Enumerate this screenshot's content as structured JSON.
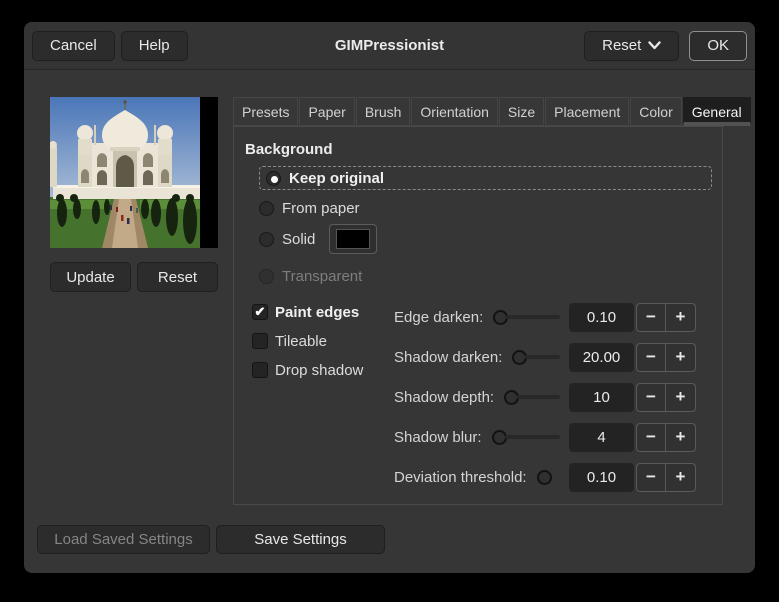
{
  "window": {
    "title": "GIMPressionist"
  },
  "header": {
    "cancel_label": "Cancel",
    "help_label": "Help",
    "reset_label": "Reset",
    "ok_label": "OK"
  },
  "preview": {
    "update_label": "Update",
    "reset_label": "Reset"
  },
  "tabs": [
    {
      "label": "Presets"
    },
    {
      "label": "Paper"
    },
    {
      "label": "Brush"
    },
    {
      "label": "Orientation"
    },
    {
      "label": "Size"
    },
    {
      "label": "Placement"
    },
    {
      "label": "Color"
    },
    {
      "label": "General",
      "active": true
    }
  ],
  "general_tab": {
    "section_title": "Background",
    "radios": [
      {
        "label": "Keep original",
        "selected": true
      },
      {
        "label": "From paper",
        "selected": false
      },
      {
        "label": "Solid",
        "selected": false,
        "swatch_color": "#000000"
      },
      {
        "label": "Transparent",
        "selected": false,
        "disabled": true
      }
    ],
    "checkboxes": [
      {
        "label": "Paint edges",
        "checked": true
      },
      {
        "label": "Tileable",
        "checked": false
      },
      {
        "label": "Drop shadow",
        "checked": false
      }
    ],
    "sliders": [
      {
        "label": "Edge darken:",
        "value": "0.10"
      },
      {
        "label": "Shadow darken:",
        "value": "20.00"
      },
      {
        "label": "Shadow depth:",
        "value": "10"
      },
      {
        "label": "Shadow blur:",
        "value": "4"
      },
      {
        "label": "Deviation threshold:",
        "value": "0.10"
      }
    ]
  },
  "icons": {
    "check": "✔",
    "minus": "−",
    "plus": "+"
  },
  "footer": {
    "load_label": "Load Saved Settings",
    "save_label": "Save Settings"
  },
  "colors": {
    "dialog_bg": "#363636",
    "active_tab_bg": "#1e1e1e",
    "entry_bg": "#232323",
    "solid_swatch": "#000000"
  }
}
